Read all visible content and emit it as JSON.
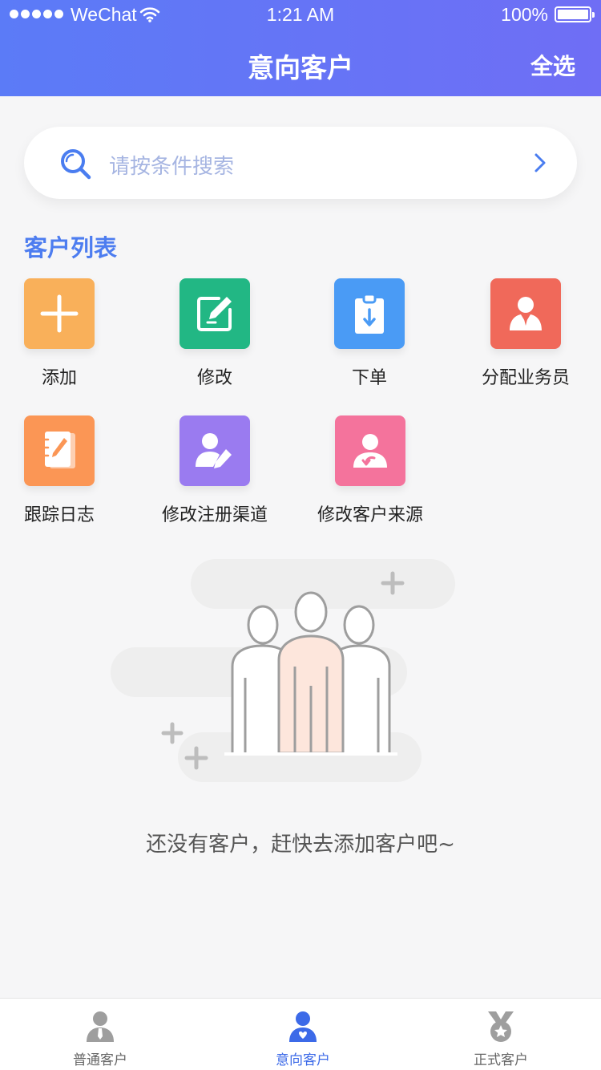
{
  "status_bar": {
    "carrier": "WeChat",
    "time": "1:21 AM",
    "battery": "100%"
  },
  "header": {
    "title": "意向客户",
    "select_all": "全选"
  },
  "search": {
    "placeholder": "请按条件搜索"
  },
  "section_title": "客户列表",
  "actions": [
    {
      "label": "添加",
      "icon": "plus-icon",
      "color": "#f9b05a"
    },
    {
      "label": "修改",
      "icon": "edit-icon",
      "color": "#22b784"
    },
    {
      "label": "下单",
      "icon": "clipboard-download-icon",
      "color": "#4a9bf5"
    },
    {
      "label": "分配业务员",
      "icon": "salesperson-icon",
      "color": "#f0695a"
    },
    {
      "label": "跟踪日志",
      "icon": "notebook-icon",
      "color": "#fb9655"
    },
    {
      "label": "修改注册渠道",
      "icon": "user-edit-icon",
      "color": "#9a7bf0"
    },
    {
      "label": "修改客户来源",
      "icon": "user-return-icon",
      "color": "#f4739c"
    }
  ],
  "empty_state": {
    "message": "还没有客户，赶快去添加客户吧~"
  },
  "tabs": [
    {
      "label": "普通客户",
      "icon": "user-tie-icon",
      "active": false
    },
    {
      "label": "意向客户",
      "icon": "user-heart-icon",
      "active": true
    },
    {
      "label": "正式客户",
      "icon": "medal-icon",
      "active": false
    }
  ],
  "colors": {
    "header_gradient_start": "#5b7bf7",
    "header_gradient_end": "#6f6ef5",
    "accent": "#4d7df0",
    "active_tab": "#3c6ae8"
  }
}
